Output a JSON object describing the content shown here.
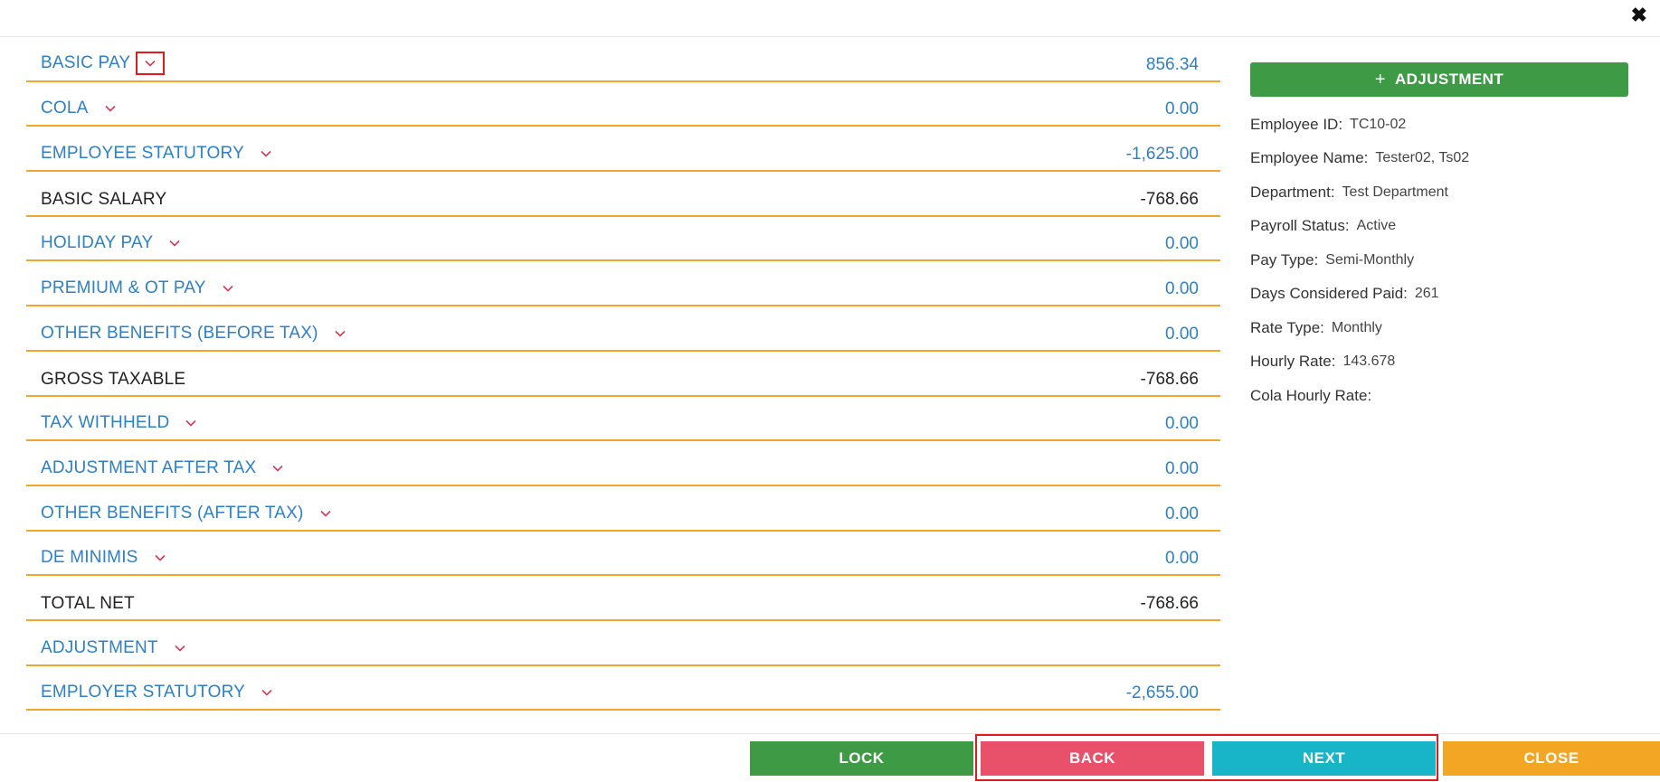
{
  "header": {
    "close_icon": "✖"
  },
  "rows": [
    {
      "label": "BASIC PAY",
      "value": "856.34",
      "style": "link",
      "dropdown": true,
      "highlighted": true
    },
    {
      "label": "COLA",
      "value": "0.00",
      "style": "link",
      "dropdown": true
    },
    {
      "label": "EMPLOYEE STATUTORY",
      "value": "-1,625.00",
      "style": "link",
      "dropdown": true
    },
    {
      "label": "BASIC SALARY",
      "value": "-768.66",
      "style": "plain",
      "dropdown": false
    },
    {
      "label": "HOLIDAY PAY",
      "value": "0.00",
      "style": "link",
      "dropdown": true
    },
    {
      "label": "PREMIUM & OT PAY",
      "value": "0.00",
      "style": "link",
      "dropdown": true
    },
    {
      "label": "OTHER BENEFITS (BEFORE TAX)",
      "value": "0.00",
      "style": "link",
      "dropdown": true
    },
    {
      "label": "GROSS TAXABLE",
      "value": "-768.66",
      "style": "plain",
      "dropdown": false
    },
    {
      "label": "TAX WITHHELD",
      "value": "0.00",
      "style": "link",
      "dropdown": true
    },
    {
      "label": "ADJUSTMENT AFTER TAX",
      "value": "0.00",
      "style": "link",
      "dropdown": true
    },
    {
      "label": "OTHER BENEFITS (AFTER TAX)",
      "value": "0.00",
      "style": "link",
      "dropdown": true
    },
    {
      "label": "DE MINIMIS",
      "value": "0.00",
      "style": "link",
      "dropdown": true
    },
    {
      "label": "TOTAL NET",
      "value": "-768.66",
      "style": "plain",
      "dropdown": false
    },
    {
      "label": "ADJUSTMENT",
      "value": "",
      "style": "link",
      "dropdown": true
    },
    {
      "label": "EMPLOYER STATUTORY",
      "value": "-2,655.00",
      "style": "link",
      "dropdown": true
    }
  ],
  "side": {
    "adjustment_button": "ADJUSTMENT",
    "adjustment_icon": "+",
    "info": [
      {
        "key": "Employee ID:",
        "value": "TC10-02"
      },
      {
        "key": "Employee Name:",
        "value": "Tester02, Ts02"
      },
      {
        "key": "Department:",
        "value": "Test Department"
      },
      {
        "key": "Payroll Status:",
        "value": "Active"
      },
      {
        "key": "Pay Type:",
        "value": "Semi-Monthly"
      },
      {
        "key": "Days Considered Paid:",
        "value": "261"
      },
      {
        "key": "Rate Type:",
        "value": "Monthly"
      },
      {
        "key": "Hourly Rate:",
        "value": "143.678"
      },
      {
        "key": "Cola Hourly Rate:",
        "value": ""
      }
    ]
  },
  "footer": {
    "lock": "LOCK",
    "back": "BACK",
    "next": "NEXT",
    "close": "CLOSE"
  },
  "colors": {
    "link": "#2d7fc6",
    "divider": "#f0a72c",
    "chevron": "#d23a55",
    "green": "#3e9a44",
    "pink": "#e9506a",
    "teal": "#18b5c9",
    "orange": "#f3a623",
    "highlight": "#e01b1b"
  }
}
